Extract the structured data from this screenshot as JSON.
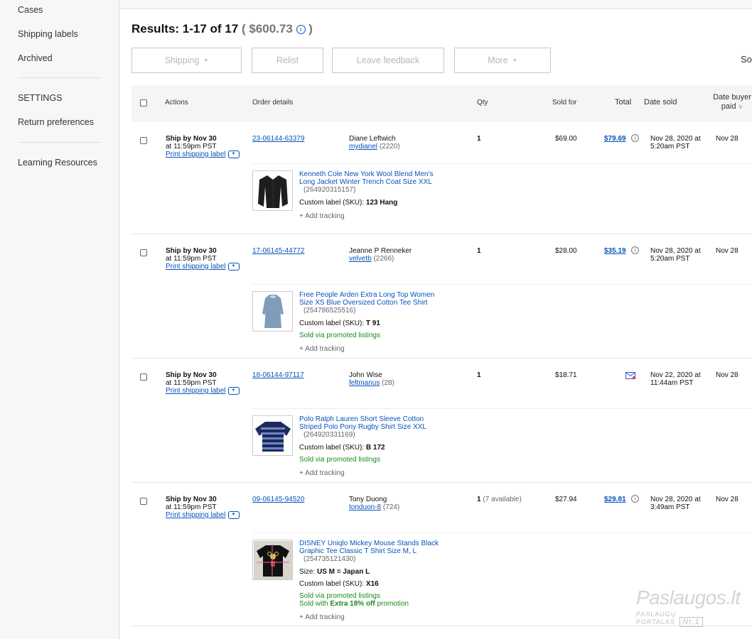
{
  "sidebar": {
    "items": [
      {
        "label": "Cases"
      },
      {
        "label": "Shipping labels"
      },
      {
        "label": "Archived"
      },
      {
        "label": "SETTINGS"
      },
      {
        "label": "Return preferences"
      },
      {
        "label": "Learning Resources"
      }
    ]
  },
  "header": {
    "results": "Results: 1-17 of 17",
    "total": "( $600.73",
    "total_close": ")",
    "info_icon": "i"
  },
  "toolbar": {
    "shipping": "Shipping",
    "relist": "Relist",
    "leave_feedback": "Leave feedback",
    "more": "More",
    "sort": "Sor"
  },
  "columns": {
    "actions": "Actions",
    "order_details": "Order details",
    "qty": "Qty",
    "sold_for": "Sold for",
    "total": "Total",
    "date_sold": "Date sold",
    "date_buyer_paid": "Date buyer paid",
    "sort_caret": "∨"
  },
  "orders": [
    {
      "ship_by": "Ship by Nov 30",
      "ship_time": "at 11:59pm PST",
      "print_label": "Print shipping label",
      "order_id": "23-06144-63379",
      "buyer_name": "Diane Leftwich",
      "buyer_user": "mydianel",
      "buyer_score": "(2220)",
      "qty": "1",
      "qty_extra": "",
      "sold_for": "$69.00",
      "total": "$79.69",
      "date_sold_1": "Nov 28, 2020 at",
      "date_sold_2": "5:20am PST",
      "date_paid": "Nov 28",
      "item_title_1": "Kenneth Cole New York Wool Blend Men's",
      "item_title_2": "Long Jacket Winter Trench Coat Size XXL",
      "item_number": "(264920315157)",
      "sku_label": "Custom label (SKU):",
      "sku": "123 Hang",
      "add_tracking": "Add tracking"
    },
    {
      "ship_by": "Ship by Nov 30",
      "ship_time": "at 11:59pm PST",
      "print_label": "Print shipping label",
      "order_id": "17-06145-44772",
      "buyer_name": "Jeanne P Renneker",
      "buyer_user": "velvetb",
      "buyer_score": "(2266)",
      "qty": "1",
      "qty_extra": "",
      "sold_for": "$28.00",
      "total": "$35.19",
      "date_sold_1": "Nov 28, 2020 at",
      "date_sold_2": "5:20am PST",
      "date_paid": "Nov 28",
      "item_title_1": "Free People Arden Extra Long Top Women",
      "item_title_2": "Size XS Blue Oversized Cotton Tee Shirt",
      "item_number": "(254786525516)",
      "sku_label": "Custom label (SKU):",
      "sku": "T 91",
      "promo": "Sold via promoted listings",
      "add_tracking": "Add tracking"
    },
    {
      "ship_by": "Ship by Nov 30",
      "ship_time": "at 11:59pm PST",
      "print_label": "Print shipping label",
      "order_id": "18-06144-97117",
      "buyer_name": "John Wise",
      "buyer_user": "feltmanus",
      "buyer_score": "(28)",
      "qty": "1",
      "qty_extra": "",
      "sold_for": "$18.71",
      "total": "",
      "date_sold_1": "Nov 22, 2020 at",
      "date_sold_2": "11:44am PST",
      "date_paid": "Nov 28",
      "item_title_1": "Polo Ralph Lauren Short Sleeve Cotton",
      "item_title_2": "Striped Polo Pony Rugby Shirt Size XXL",
      "item_number": "(264920331169)",
      "sku_label": "Custom label (SKU):",
      "sku": "B 172",
      "promo": "Sold via promoted listings",
      "add_tracking": "Add tracking"
    },
    {
      "ship_by": "Ship by Nov 30",
      "ship_time": "at 11:59pm PST",
      "print_label": "Print shipping label",
      "order_id": "09-06145-94520",
      "buyer_name": "Tony Duong",
      "buyer_user": "tonduon-8",
      "buyer_score": "(724)",
      "qty": "1",
      "qty_extra": "(7 available)",
      "sold_for": "$27.94",
      "total": "$29.81",
      "date_sold_1": "Nov 28, 2020 at",
      "date_sold_2": "3:49am PST",
      "date_paid": "Nov 28",
      "item_title_1": "DISNEY Uniqlo Mickey Mouse Stands Black",
      "item_title_2": "Graphic Tee Classic T Shirt Size M, L",
      "item_number": "(254735121430)",
      "size_label": "Size:",
      "size": "US M = Japan L",
      "sku_label": "Custom label (SKU):",
      "sku": "X16",
      "promo": "Sold via promoted listings",
      "promo2_prefix": "Sold with",
      "promo2_bold": "Extra 18% off",
      "promo2_suffix": "promotion",
      "add_tracking": "Add tracking"
    }
  ],
  "watermark": {
    "brand": "Paslaugos.lt",
    "tagline": "PASLAUGŲ PORTALAS",
    "nr": "Nr.1"
  },
  "colors": {
    "link": "#0654ba",
    "promo_green": "#1b8a1b",
    "header_bg": "#f5f5f5"
  }
}
